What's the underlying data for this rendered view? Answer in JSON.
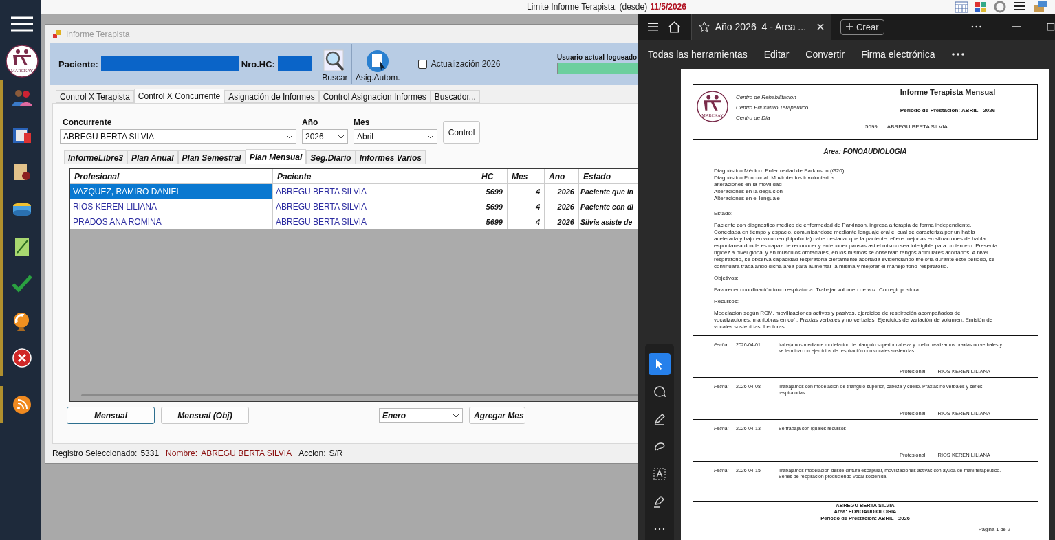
{
  "top_bar": {
    "limit_label": "Limite Informe Terapista: (desde)",
    "limit_date": "11/5/2026"
  },
  "sidebar": {
    "logo_text": "MARCKAY"
  },
  "main_window": {
    "title": "Informe Terapista",
    "search": {
      "patient_label": "Paciente:",
      "hc_label": "Nro.HC:",
      "search_button": "Buscar",
      "auto_assign_button": "Asig.Autom.",
      "update_checkbox": {
        "label": "Actualización 2026",
        "checked": false
      },
      "user_label": "Usuario actual logueado"
    },
    "tabs": [
      {
        "label": "Control X Terapista",
        "selected": false
      },
      {
        "label": "Control X Concurrente",
        "selected": true
      },
      {
        "label": "Asignación de Informes",
        "selected": false
      },
      {
        "label": "Control Asignacion Informes",
        "selected": false
      },
      {
        "label": "Buscador...",
        "selected": false
      }
    ],
    "filters": {
      "concurrente": {
        "label": "Concurrente",
        "value": "ABREGU BERTA SILVIA"
      },
      "year": {
        "label": "Año",
        "value": "2026"
      },
      "month": {
        "label": "Mes",
        "value": "Abril"
      },
      "control_button": "Control"
    },
    "sub_tabs": [
      {
        "label": "InformeLibre3",
        "selected": false
      },
      {
        "label": "Plan Anual",
        "selected": false
      },
      {
        "label": "Plan Semestral",
        "selected": false
      },
      {
        "label": "Plan Mensual",
        "selected": true
      },
      {
        "label": "Seg.Diario",
        "selected": false
      },
      {
        "label": "Informes Varios",
        "selected": false
      }
    ],
    "table": {
      "columns": [
        "Profesional",
        "Paciente",
        "HC",
        "Mes",
        "Ano",
        "Estado"
      ],
      "rows": [
        {
          "cells": [
            "VAZQUEZ, RAMIRO DANIEL",
            "ABREGU BERTA SILVIA",
            "5699",
            "4",
            "2026",
            "Paciente que in"
          ],
          "selected": true
        },
        {
          "cells": [
            "RIOS KEREN LILIANA",
            "ABREGU BERTA SILVIA",
            "5699",
            "4",
            "2026",
            "Paciente con di"
          ],
          "selected": false
        },
        {
          "cells": [
            "PRADOS ANA ROMINA",
            "ABREGU BERTA SILVIA",
            "5699",
            "4",
            "2026",
            "Silvia asiste de"
          ],
          "selected": false
        }
      ]
    },
    "actions": {
      "buttons": [
        {
          "label": "Mensual",
          "selected": true
        },
        {
          "label": "Mensual (Obj)",
          "selected": false
        }
      ],
      "month_select": "Enero",
      "add_month_button": "Agregar Mes"
    },
    "status_bar": [
      {
        "label": "Registro Seleccionado:",
        "value": "5331",
        "kind": "plain"
      },
      {
        "label": "Nombre:",
        "value": "ABREGU BERTA SILVIA",
        "kind": "highlight"
      },
      {
        "label": "Accion:",
        "value": "S/R",
        "kind": "plain"
      }
    ]
  },
  "pdf_viewer": {
    "tab_title": "Año 2026_4 - Area ...",
    "create_button": "Crear",
    "menu": [
      "Todas las herramientas",
      "Editar",
      "Convertir",
      "Firma electrónica"
    ],
    "document": {
      "logo_text": "MARCKAY",
      "center_lines": [
        "Centro de Rehabilitacion",
        "Centro Educativo Terapeutico",
        "Centro de Dia"
      ],
      "title": "Informe Terapista Mensual",
      "period": "Periodo de Prestación: ABRIL - 2026",
      "patient_hc": "5699",
      "patient_name": "ABREGU BERTA SILVIA",
      "area": "Area: FONOAUDIOLOGIA",
      "diagnosis_lines": [
        "Diagnóstico Médico: Enfermedad de Parkinson (G20)",
        "Diagnóstico Funcional: Movimientos involuntarios",
        "alteraciones en la movilidad",
        "Alteraciones en la deglucion",
        "Alteraciones en el lenguaje"
      ],
      "sections": [
        {
          "heading": "Estado:",
          "text": "Paciente con diagnostico medico de enfermedad de Parkinson, ingresa a terapia de forma independiente. Conectada en tiempo y espacio, comunicándose mediante lenguaje oral el cual se caracteriza por un habla acelerada y bajo en volumen (hipofonia) cabe destacar que la paciente refiere mejorias en situaciones de habla espontanea donde es capaz de reconocer y anteponer pausas asi el mismo sea inteligible para un tercero. Presenta rigidez a nivel global y en músculos orofaciales, en los mismos se observan rangos articulares acortados. A nivel respiratorio, se observa capacidad respiratoria ciertamente acortada evidenciando mejoria durante este periodo, se continuara trabajando dicha área para aumentar la misma y mejorar el manejo fono-respiratorio."
        },
        {
          "heading": "Objetivos:",
          "text": "Favorecer coordinación fono respiratoria. Trabajar volumen de voz. Corregir postura"
        },
        {
          "heading": "Recursos:",
          "text": "Modelacion según RCM. movilizaciones activas y pasivas. ejercicios de respiración acompañados de vocalizaciones, maniobras en cof . Praxias verbales y no verbales. Ejercicios de variación de volumen. Emisión de vocales sostenidas. Lecturas."
        }
      ],
      "entries": [
        {
          "date_label": "Fecha:",
          "date": "2026-04-01",
          "text": "trabajamos mediante modelacion de triangulo superior cabeza y cuello. realizamos praxias no verbales y se termina con ejercicios de respiración con vocales sostenidas",
          "professional_label": "Profesional",
          "professional": "RIOS KEREN LILIANA"
        },
        {
          "date_label": "Fecha:",
          "date": "2026-04-08",
          "text": "Trabajamos con modelacion de triángulo superior, cabeza y cuello. Praxias no verbales y series respiratorias",
          "professional_label": "Profesional",
          "professional": "RIOS KEREN LILIANA"
        },
        {
          "date_label": "Fecha:",
          "date": "2026-04-13",
          "text": "Se trabaja con iguales recursos",
          "professional_label": "Profesional",
          "professional": "RIOS KEREN LILIANA"
        },
        {
          "date_label": "Fecha:",
          "date": "2026-04-15",
          "text": "Trabajamos modelacion desde cintura escapular, movilizaciones activas con ayuda de mani terapéutico. Series de respiración produciendo vocal sostenida"
        }
      ],
      "footer": {
        "patient": "ABREGU BERTA SILVIA",
        "area": "Area: FONOAUDIOLOGIA",
        "period": "Periodo de Prestación: ABRIL - 2026",
        "page": "Página 1 de 2"
      }
    }
  }
}
